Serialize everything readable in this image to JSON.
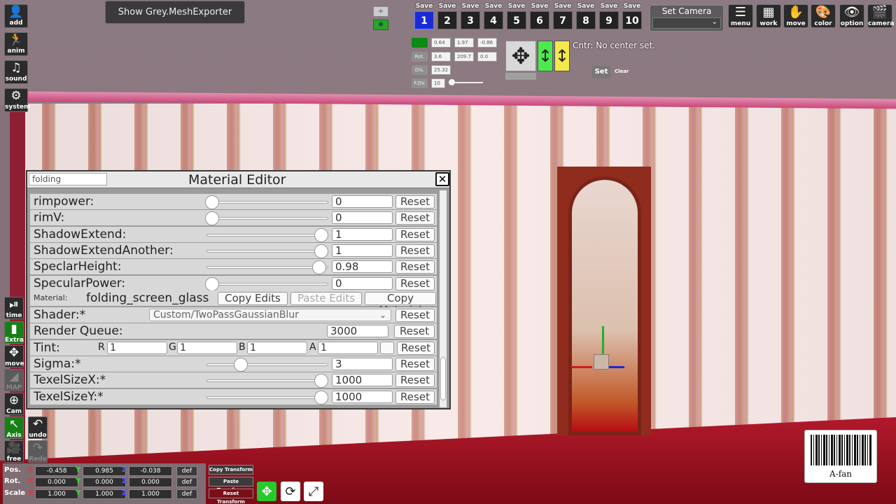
{
  "toolbar": {
    "mesh_exporter_label": "Show Grey.MeshExporter",
    "set_camera_label": "Set Camera",
    "save_label": "Save",
    "save_slots": [
      "1",
      "2",
      "3",
      "4",
      "5",
      "6",
      "7",
      "8",
      "9",
      "10"
    ],
    "right_icons": [
      {
        "glyph": "☰",
        "label": "menu"
      },
      {
        "glyph": "▦",
        "label": "work"
      },
      {
        "glyph": "✋",
        "label": "move"
      },
      {
        "glyph": "🎨",
        "label": "color"
      },
      {
        "glyph": "👁",
        "label": "option"
      },
      {
        "glyph": "🎬",
        "label": "camera"
      }
    ]
  },
  "camera_panel": {
    "pos_values": [
      "0.64",
      "1.97",
      "-0.86"
    ],
    "rot_label": "Rot.",
    "rot_values": [
      "3.6",
      "209.7",
      "0.0"
    ],
    "dis_label": "Dis.",
    "dis_value": "25.32",
    "fov_label": "F.OV.",
    "fov_value": "10",
    "center_text": "Cntr: No center set.",
    "set_label": "Set",
    "clear_label": "Clear"
  },
  "left_toolbar": [
    {
      "glyph": "👤",
      "label": "add"
    },
    {
      "glyph": "🏃",
      "label": "anim"
    },
    {
      "glyph": "♫",
      "label": "sound"
    },
    {
      "glyph": "⚙",
      "label": "system"
    },
    {
      "glyph": "⏯",
      "label": "time"
    },
    {
      "glyph": "▮",
      "label": "Extra"
    },
    {
      "glyph": "✥",
      "label": "move"
    },
    {
      "glyph": "◢",
      "label": "MAP"
    },
    {
      "glyph": "⊕",
      "label": "Cam"
    },
    {
      "glyph": "↖",
      "label": "Axis"
    },
    {
      "glyph": "🎥",
      "label": "free"
    },
    {
      "glyph": "↶",
      "label": "undo"
    },
    {
      "glyph": "↷",
      "label": "Redo"
    }
  ],
  "material_editor": {
    "search_value": "folding",
    "title": "Material Editor",
    "close_glyph": "✕",
    "reset_label": "Reset",
    "props": [
      {
        "name": "rimpower:",
        "value": "0",
        "level": 0.0
      },
      {
        "name": "rimV:",
        "value": "0",
        "level": 0.0
      },
      {
        "name": "ShadowExtend:",
        "value": "1",
        "level": 1.0
      },
      {
        "name": "ShadowExtendAnother:",
        "value": "1",
        "level": 1.0
      },
      {
        "name": "SpeclarHeight:",
        "value": "0.98",
        "level": 0.98
      },
      {
        "name": "SpecularPower:",
        "value": "0",
        "level": 0.0
      }
    ],
    "material_label": "Material:",
    "material_name": "folding_screen_glass",
    "copy_edits": "Copy Edits",
    "paste_edits": "Paste Edits",
    "copy_material": "Copy Material",
    "shader_label": "Shader:*",
    "shader_value": "Custom/TwoPassGaussianBlur",
    "render_queue_label": "Render Queue:",
    "render_queue_value": "3000",
    "tint_label": "Tint:",
    "tint": {
      "R": "1",
      "G": "1",
      "B": "1",
      "A": "1"
    },
    "props2": [
      {
        "name": "Sigma:*",
        "value": "3",
        "level": 0.26
      },
      {
        "name": "TexelSizeX:*",
        "value": "1000",
        "level": 1.0
      },
      {
        "name": "TexelSizeY:*",
        "value": "1000",
        "level": 1.0
      }
    ]
  },
  "transform_panel": {
    "pos_label": "Pos.",
    "rot_label": "Rot.",
    "scale_label": "Scale",
    "axes": [
      "X",
      "Y",
      "Z"
    ],
    "pos": [
      "-0.458",
      "0.985",
      "-0.038"
    ],
    "rot": [
      "0.000",
      "0.000",
      "0.000"
    ],
    "scale": [
      "1.000",
      "1.000",
      "1.000"
    ],
    "def_label": "def",
    "copy_transform": "Copy Transform",
    "paste_transform": "Paste Transform",
    "reset_transform": "Reset Transform"
  },
  "barcode_label": "A-fan"
}
